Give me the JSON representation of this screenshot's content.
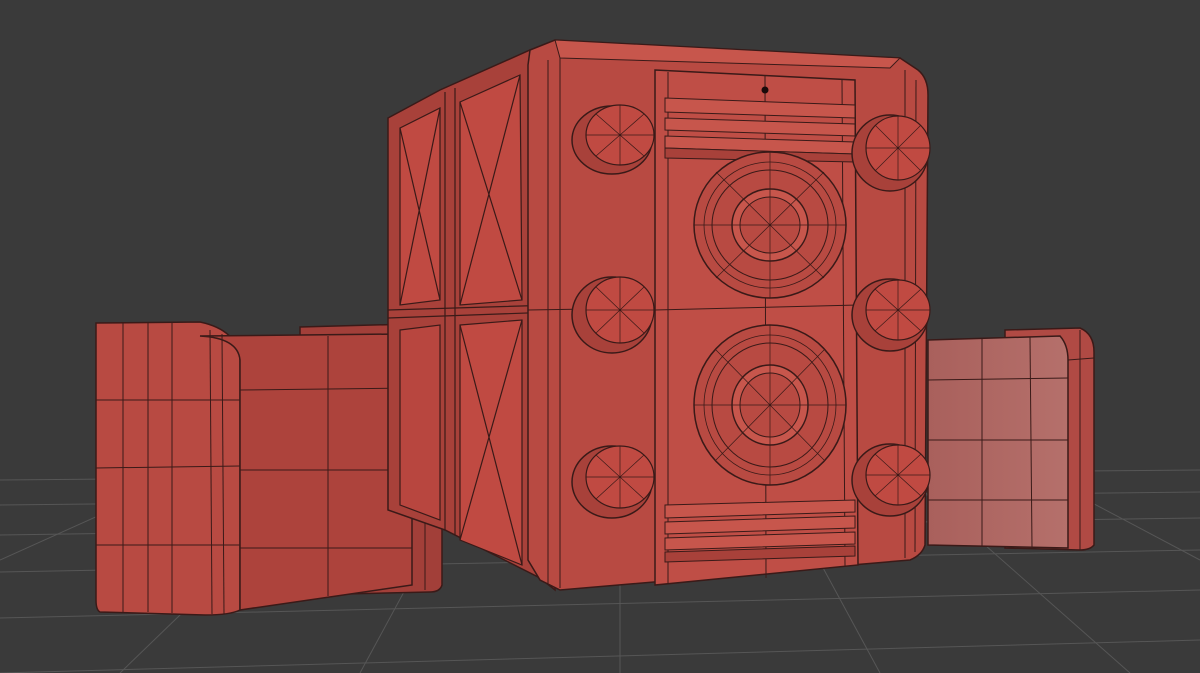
{
  "viewport": {
    "kind": "3d-viewport",
    "shading": "wireframe-on-shaded",
    "colors": {
      "background": "#3a3a3a",
      "grid": "#5a5a5a",
      "model": "#b84a42",
      "model_light": "#c7564c",
      "model_dark": "#8e342f",
      "wire": "#3a1a18"
    }
  },
  "scene": {
    "objects": [
      {
        "name": "speaker-cabinet",
        "icon": "cube-icon"
      },
      {
        "name": "left-satellite-box",
        "icon": "cube-icon"
      },
      {
        "name": "right-satellite-box",
        "icon": "cube-icon"
      }
    ],
    "cabinet": {
      "woofers": 2,
      "knobs_per_side": 3,
      "vent_grilles": 2,
      "side_panels": 4
    }
  }
}
